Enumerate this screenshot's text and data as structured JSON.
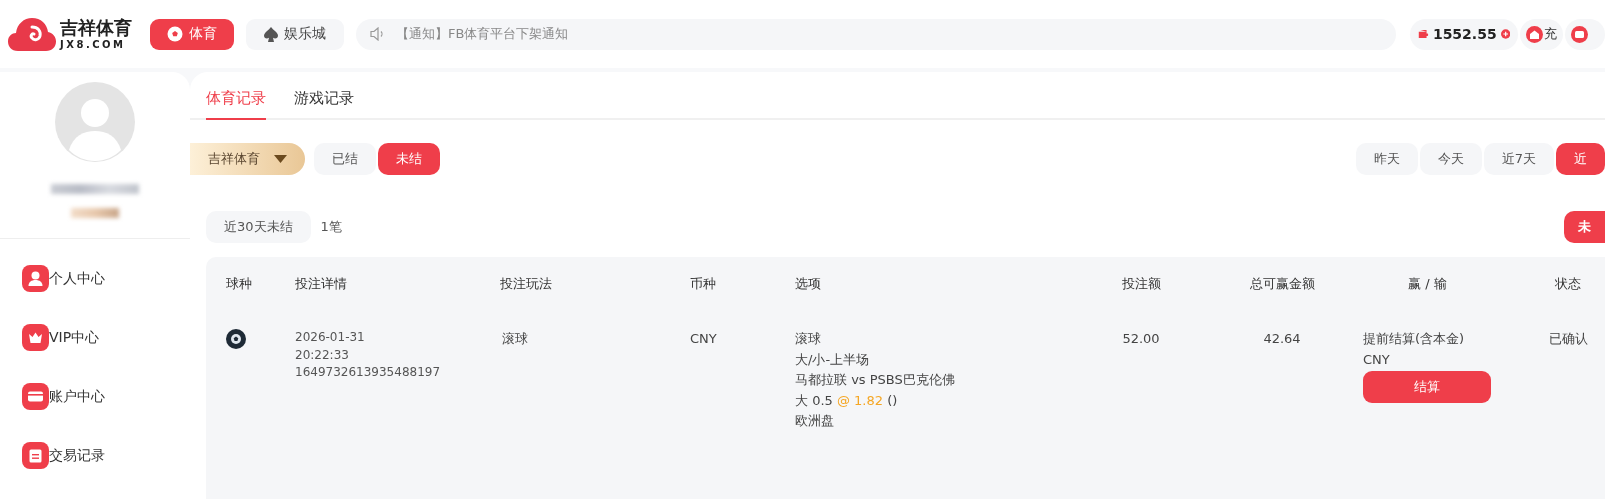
{
  "header": {
    "logo": {
      "name": "吉祥体育",
      "domain": "JX8.COM"
    },
    "nav": [
      {
        "label": "体育",
        "kind": "ball",
        "selected": true
      },
      {
        "label": "娱乐城",
        "kind": "spade",
        "selected": false
      }
    ],
    "notice": "【通知】FB体育平台下架通知",
    "balance": "1552.55",
    "charge": "充"
  },
  "sidebar": {
    "menu": [
      {
        "label": "个人中心",
        "kind": "user"
      },
      {
        "label": "VIP中心",
        "kind": "crown"
      },
      {
        "label": "账户中心",
        "kind": "card"
      },
      {
        "label": "交易记录",
        "kind": "list"
      }
    ]
  },
  "tabs": [
    {
      "label": "体育记录",
      "selected": true
    },
    {
      "label": "游戏记录",
      "selected": false
    }
  ],
  "provider": "吉祥体育",
  "status_filters": [
    {
      "label": "已结",
      "selected": false
    },
    {
      "label": "未结",
      "selected": true
    }
  ],
  "date_filters": [
    {
      "label": "昨天",
      "selected": false
    },
    {
      "label": "今天",
      "selected": false
    },
    {
      "label": "近7天",
      "selected": false
    },
    {
      "label": "近",
      "selected": true
    }
  ],
  "summary": {
    "label": "近30天未结",
    "count": "1笔",
    "action": "未"
  },
  "table": {
    "columns": [
      "球种",
      "投注详情",
      "投注玩法",
      "币种",
      "选项",
      "投注额",
      "总可赢金额",
      "赢 / 输",
      "状态"
    ],
    "rows": [
      {
        "date": "2026-01-31",
        "time": "20:22:33",
        "id": "1649732613935488197",
        "play": "滚球",
        "currency": "CNY",
        "selection": {
          "lines": [
            "滚球",
            "大/小-上半场",
            "马都拉联 vs PSBS巴克伦佛"
          ],
          "pick": "大 0.5",
          "odds": "@ 1.82",
          "extra": "()",
          "market": "欧洲盘"
        },
        "stake": "52.00",
        "potential": "42.64",
        "result": {
          "text": "提前结算(含本金)",
          "currency": "CNY",
          "button": "结算"
        },
        "status": "已确认"
      }
    ]
  }
}
